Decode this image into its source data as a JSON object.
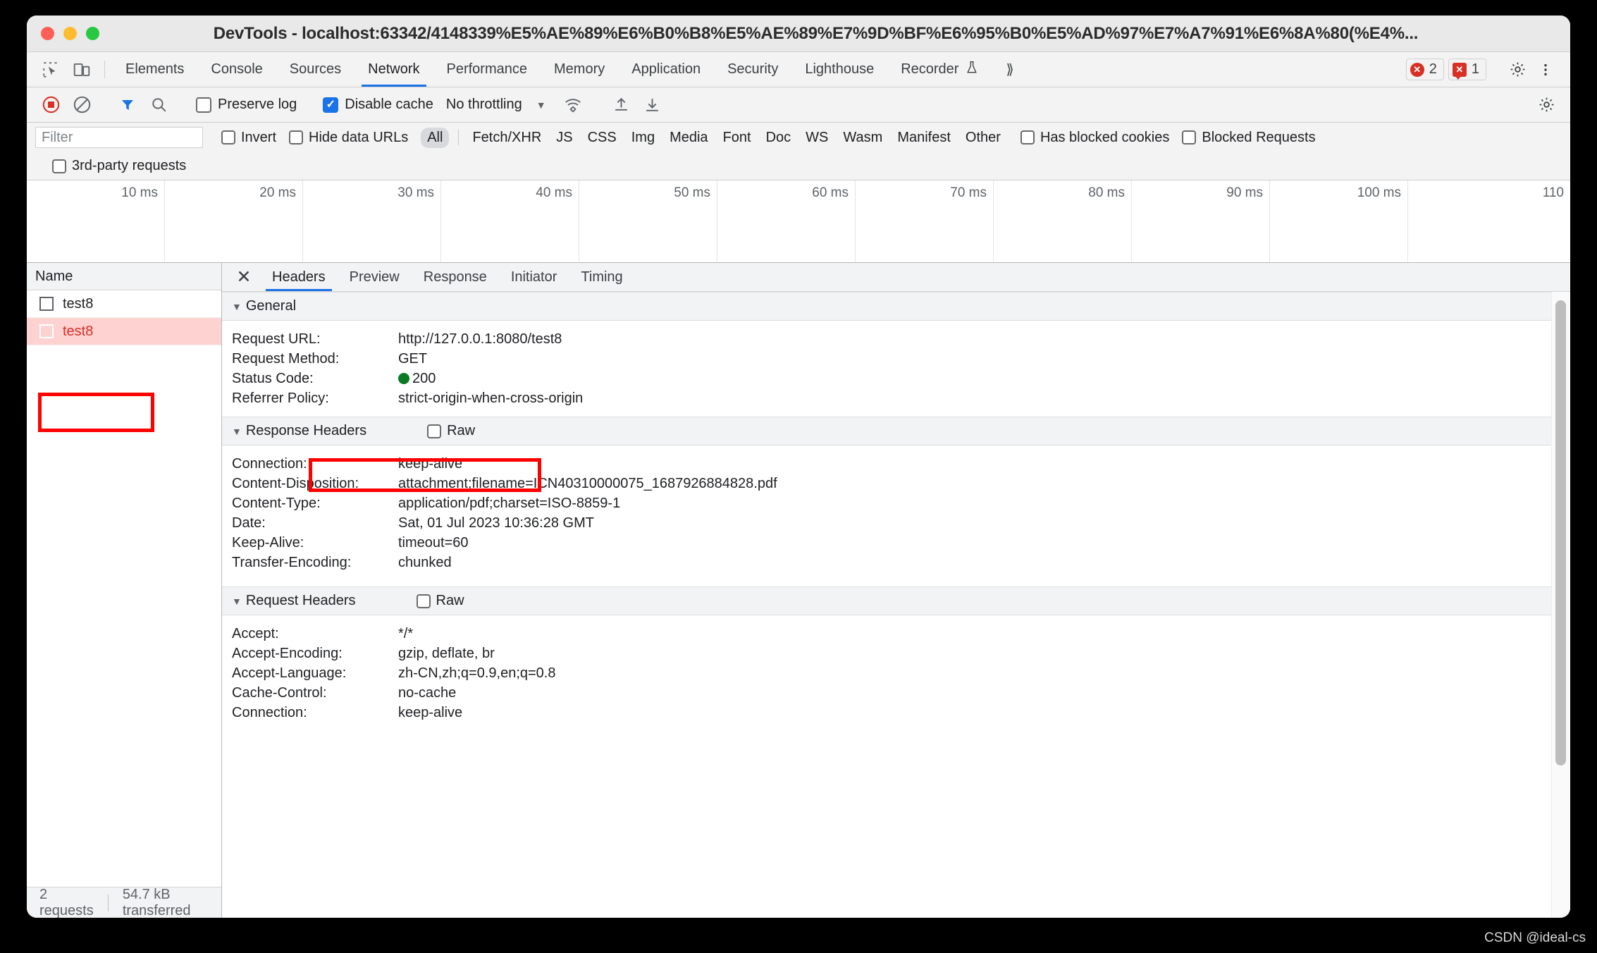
{
  "window": {
    "title": "DevTools - localhost:63342/4148339%E5%AE%89%E6%B0%B8%E5%AE%89%E7%9D%BF%E6%95%B0%E5%AD%97%E7%A7%91%E6%8A%80(%E4%...",
    "traffic_lights": [
      "close-button",
      "minimize-button",
      "zoom-button"
    ]
  },
  "devtools_tabs": {
    "items": [
      {
        "label": "Elements",
        "active": false
      },
      {
        "label": "Console",
        "active": false
      },
      {
        "label": "Sources",
        "active": false
      },
      {
        "label": "Network",
        "active": true
      },
      {
        "label": "Performance",
        "active": false
      },
      {
        "label": "Memory",
        "active": false
      },
      {
        "label": "Application",
        "active": false
      },
      {
        "label": "Security",
        "active": false
      },
      {
        "label": "Lighthouse",
        "active": false
      },
      {
        "label": "Recorder",
        "active": false
      }
    ],
    "overflow_label": "⟫",
    "errors_count": "2",
    "warnings_count": "1",
    "settings_icon": "gear-icon",
    "more_icon": "kebab-menu-icon"
  },
  "network_toolbar": {
    "record_icon": "record-stop-icon",
    "clear_icon": "clear-icon",
    "filter_icon": "filter-funnel-icon",
    "search_icon": "search-icon",
    "preserve_log_label": "Preserve log",
    "preserve_log_checked": false,
    "disable_cache_label": "Disable cache",
    "disable_cache_checked": true,
    "throttling_value": "No throttling",
    "wifi_icon": "network-conditions-icon",
    "import_icon": "import-har-icon",
    "export_icon": "export-har-icon",
    "settings_icon": "gear-icon"
  },
  "filter_bar": {
    "filter_placeholder": "Filter",
    "filter_value": "",
    "invert_label": "Invert",
    "invert_checked": false,
    "hide_data_urls_label": "Hide data URLs",
    "hide_data_urls_checked": false,
    "resource_types": [
      {
        "label": "All",
        "selected": true
      },
      {
        "label": "Fetch/XHR",
        "selected": false
      },
      {
        "label": "JS",
        "selected": false
      },
      {
        "label": "CSS",
        "selected": false
      },
      {
        "label": "Img",
        "selected": false
      },
      {
        "label": "Media",
        "selected": false
      },
      {
        "label": "Font",
        "selected": false
      },
      {
        "label": "Doc",
        "selected": false
      },
      {
        "label": "WS",
        "selected": false
      },
      {
        "label": "Wasm",
        "selected": false
      },
      {
        "label": "Manifest",
        "selected": false
      },
      {
        "label": "Other",
        "selected": false
      }
    ],
    "has_blocked_cookies_label": "Has blocked cookies",
    "has_blocked_cookies_checked": false,
    "blocked_requests_label": "Blocked Requests",
    "blocked_requests_checked": false,
    "third_party_label": "3rd-party requests",
    "third_party_checked": false
  },
  "overview": {
    "ticks": [
      "10 ms",
      "20 ms",
      "30 ms",
      "40 ms",
      "50 ms",
      "60 ms",
      "70 ms",
      "80 ms",
      "90 ms",
      "100 ms",
      "110"
    ]
  },
  "request_list": {
    "column_header": "Name",
    "rows": [
      {
        "name": "test8",
        "error": false
      },
      {
        "name": "test8",
        "error": true
      }
    ],
    "status_requests": "2 requests",
    "status_transferred": "54.7 kB transferred"
  },
  "detail_panel": {
    "close_icon": "close-icon",
    "tabs": [
      {
        "label": "Headers",
        "active": true
      },
      {
        "label": "Preview",
        "active": false
      },
      {
        "label": "Response",
        "active": false
      },
      {
        "label": "Initiator",
        "active": false
      },
      {
        "label": "Timing",
        "active": false
      }
    ],
    "sections": [
      {
        "title": "General",
        "has_raw": false,
        "raw_label": "",
        "rows": [
          {
            "key": "Request URL:",
            "value": "http://127.0.0.1:8080/test8",
            "status_dot": false
          },
          {
            "key": "Request Method:",
            "value": "GET",
            "status_dot": false
          },
          {
            "key": "Status Code:",
            "value": "200",
            "status_dot": true
          },
          {
            "key": "Referrer Policy:",
            "value": "strict-origin-when-cross-origin",
            "status_dot": false
          }
        ]
      },
      {
        "title": "Response Headers",
        "has_raw": true,
        "raw_label": "Raw",
        "rows": [
          {
            "key": "Connection:",
            "value": "keep-alive",
            "status_dot": false
          },
          {
            "key": "Content-Disposition:",
            "value": "attachment;filename=ICN40310000075_1687926884828.pdf",
            "status_dot": false
          },
          {
            "key": "Content-Type:",
            "value": "application/pdf;charset=ISO-8859-1",
            "status_dot": false
          },
          {
            "key": "Date:",
            "value": "Sat, 01 Jul 2023 10:36:28 GMT",
            "status_dot": false
          },
          {
            "key": "Keep-Alive:",
            "value": "timeout=60",
            "status_dot": false
          },
          {
            "key": "Transfer-Encoding:",
            "value": "chunked",
            "status_dot": false
          }
        ]
      },
      {
        "title": "Request Headers",
        "has_raw": true,
        "raw_label": "Raw",
        "rows": [
          {
            "key": "Accept:",
            "value": "*/*",
            "status_dot": false
          },
          {
            "key": "Accept-Encoding:",
            "value": "gzip, deflate, br",
            "status_dot": false
          },
          {
            "key": "Accept-Language:",
            "value": "zh-CN,zh;q=0.9,en;q=0.8",
            "status_dot": false
          },
          {
            "key": "Cache-Control:",
            "value": "no-cache",
            "status_dot": false
          },
          {
            "key": "Connection:",
            "value": "keep-alive",
            "status_dot": false
          }
        ]
      }
    ]
  },
  "annotations": {
    "highlight_color": "#ff0000",
    "boxes": [
      "selected-request-row",
      "status-code-row"
    ]
  },
  "watermark": "CSDN @ideal-cs",
  "colors": {
    "accent": "#1a73e8",
    "error": "#d93025",
    "status_ok": "#0a7b24",
    "error_row_bg": "#ffd2d2"
  }
}
